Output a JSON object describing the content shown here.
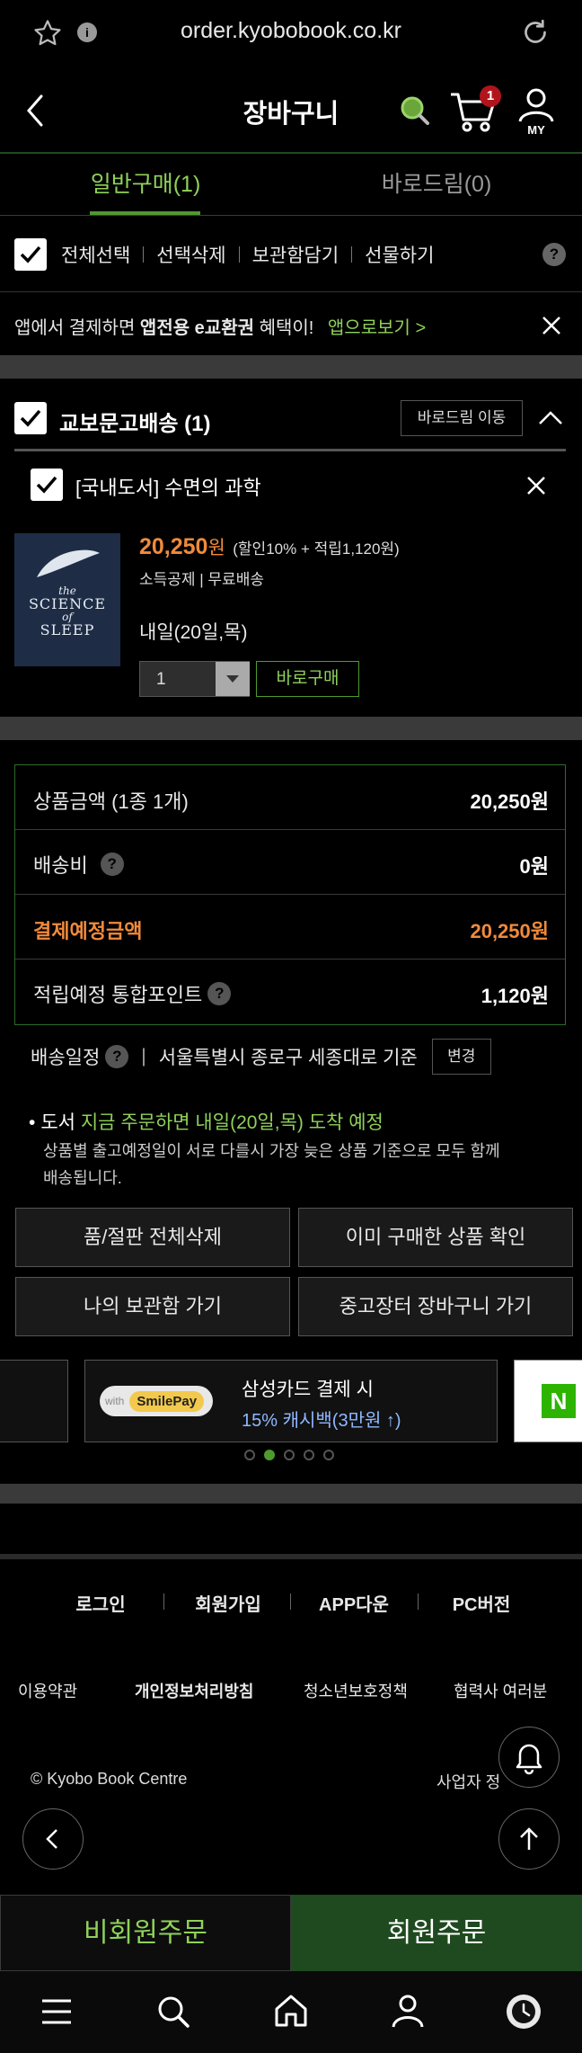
{
  "browser": {
    "url": "order.kyobobook.co.kr"
  },
  "header": {
    "title": "장바구니",
    "cart_count": "1",
    "my_label": "MY"
  },
  "tabs": [
    {
      "label": "일반구매(1)"
    },
    {
      "label": "바로드림(0)"
    }
  ],
  "toolbar": {
    "select_all": "전체선택",
    "delete_selected": "선택삭제",
    "save": "보관함담기",
    "gift": "선물하기",
    "help": "?"
  },
  "app_banner": {
    "text_prefix": "앱에서 결제하면 ",
    "text_bold": "앱전용 e교환권",
    "text_suffix": " 혜택이!",
    "link": "앱으로보기 >"
  },
  "delivery_group": {
    "title": "교보문고배송 (1)",
    "move_button": "바로드림 이동"
  },
  "item": {
    "title": "[국내도서] 수면의 과학",
    "cover_lines": [
      "the",
      "SCIENCE",
      "of",
      "SLEEP"
    ],
    "price": "20,250",
    "price_unit": "원",
    "discount_note": "(할인10% + 적립1,120원)",
    "tags": "소득공제 | 무료배송",
    "delivery_date": "내일(20일,목)",
    "quantity": "1",
    "buy_now": "바로구매"
  },
  "summary": {
    "rows": [
      {
        "label": "상품금액 (1종 1개)",
        "value": "20,250원"
      },
      {
        "label": "배송비",
        "value": "0원"
      },
      {
        "label": "결제예정금액",
        "value": "20,250원"
      },
      {
        "label": "적립예정 통합포인트",
        "value": "1,120원"
      }
    ]
  },
  "shipping_schedule": {
    "label": "배송일정",
    "location": "서울특별시 종로구 세종대로 기준",
    "change": "변경",
    "notice_prefix": "도서 ",
    "notice_highlight": "지금 주문하면 내일(20일,목) 도착 예정",
    "notice_detail_1": "상품별 출고예정일이 서로 다를시 가장 늦은 상품 기준으로 모두 함께",
    "notice_detail_2": "배송됩니다."
  },
  "actions": [
    "품/절판 전체삭제",
    "이미 구매한 상품 확인",
    "나의 보관함 가기",
    "중고장터 장바구니 가기"
  ],
  "promo": {
    "with": "with",
    "brand": "SmilePay",
    "title": "삼성카드 결제 시",
    "subtitle": "15% 캐시백(3만원 ↑)",
    "side_badge": "N"
  },
  "footer": {
    "links_top": [
      "로그인",
      "회원가입",
      "APP다운",
      "PC버전"
    ],
    "links_bottom": [
      "이용약관",
      "개인정보처리방침",
      "청소년보호정책",
      "협력사 여러분"
    ],
    "copyright": "© Kyobo Book Centre",
    "business": "사업자 정"
  },
  "order_buttons": {
    "guest": "비회원주문",
    "member": "회원주문"
  },
  "colors": {
    "accent_green": "#8fd15a",
    "dark_green": "#1f4a1f",
    "price_orange": "#f08a3b",
    "badge_red": "#b0151c"
  }
}
